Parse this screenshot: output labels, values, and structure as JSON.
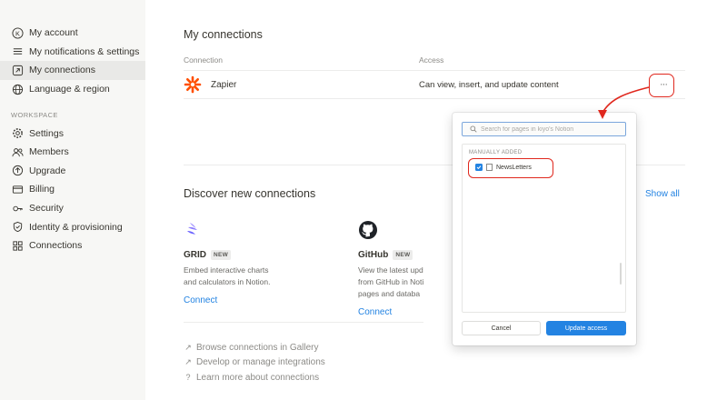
{
  "sidebar": {
    "top_items": [
      {
        "label": "My account",
        "icon": "account-k-icon"
      },
      {
        "label": "My notifications & settings",
        "icon": "sliders-icon"
      },
      {
        "label": "My connections",
        "icon": "arrow-square-icon",
        "active": true
      },
      {
        "label": "Language & region",
        "icon": "globe-icon"
      }
    ],
    "workspace_heading": "WORKSPACE",
    "workspace_items": [
      {
        "label": "Settings",
        "icon": "gear-icon"
      },
      {
        "label": "Members",
        "icon": "people-icon"
      },
      {
        "label": "Upgrade",
        "icon": "upgrade-circle-icon"
      },
      {
        "label": "Billing",
        "icon": "card-icon"
      },
      {
        "label": "Security",
        "icon": "key-icon"
      },
      {
        "label": "Identity & provisioning",
        "icon": "shield-icon"
      },
      {
        "label": "Connections",
        "icon": "grid-icon"
      }
    ]
  },
  "main": {
    "title": "My connections",
    "table": {
      "col_connection": "Connection",
      "col_access": "Access",
      "rows": [
        {
          "name": "Zapier",
          "access": "Can view, insert, and update content",
          "menu_label": "···"
        }
      ]
    },
    "discover": {
      "title": "Discover new connections",
      "show_all": "Show all",
      "cards": [
        {
          "name": "GRID",
          "badge": "NEW",
          "desc": "Embed interactive charts and calculators in Notion.",
          "connect": "Connect"
        },
        {
          "name": "GitHub",
          "badge": "NEW",
          "desc": "View the latest upd from GitHub in Noti pages and databa",
          "connect": "Connect"
        }
      ]
    },
    "links": [
      {
        "label": "Browse connections in Gallery",
        "icon": "arrow-up-right-icon"
      },
      {
        "label": "Develop or manage integrations",
        "icon": "arrow-up-right-icon"
      },
      {
        "label": "Learn more about connections",
        "icon": "help-circle-icon"
      }
    ]
  },
  "popup": {
    "search_placeholder": "Search for pages in kiyo's Notion",
    "section": "MANUALLY ADDED",
    "items": [
      {
        "label": "NewsLetters",
        "checked": true
      }
    ],
    "cancel": "Cancel",
    "update": "Update access"
  },
  "colors": {
    "accent": "#2383e2",
    "annotation": "#e0281e",
    "zapier": "#ff4f00"
  }
}
